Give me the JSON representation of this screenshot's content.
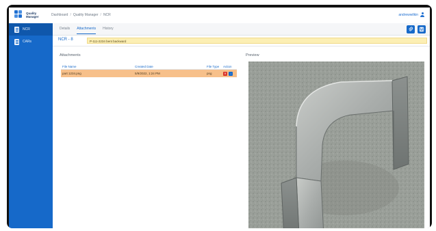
{
  "logo": {
    "line1": "Quality",
    "line2": "Manager"
  },
  "breadcrumb": [
    "Dashboard",
    "Quality Manager",
    "NCR"
  ],
  "user": {
    "name": "andrewwilkin"
  },
  "sidebar": {
    "items": [
      {
        "label": "NCR",
        "active": true
      },
      {
        "label": "CARs",
        "active": false
      }
    ]
  },
  "tabs": [
    {
      "label": "Details"
    },
    {
      "label": "Attachments",
      "active": true
    },
    {
      "label": "History"
    }
  ],
  "ncr": {
    "title": "NCR - 8",
    "description": "P-111-2234 bent backward"
  },
  "attachments": {
    "title": "Attachments",
    "columns": [
      "File Name",
      "Created Date",
      "File Type",
      "Action"
    ],
    "rows": [
      {
        "file_name": "part 1234.png",
        "created_date": "5/9/2022, 1:24 PM",
        "file_type": "png"
      }
    ]
  },
  "preview": {
    "title": "Preview"
  },
  "colors": {
    "brand": "#1669c9",
    "highlight_row": "#f7c08a",
    "description_bg": "#fcefb4"
  },
  "icons": {
    "attach": "paperclip-icon",
    "save": "save-icon",
    "delete": "delete-icon",
    "download": "download-icon",
    "user": "user-icon"
  }
}
